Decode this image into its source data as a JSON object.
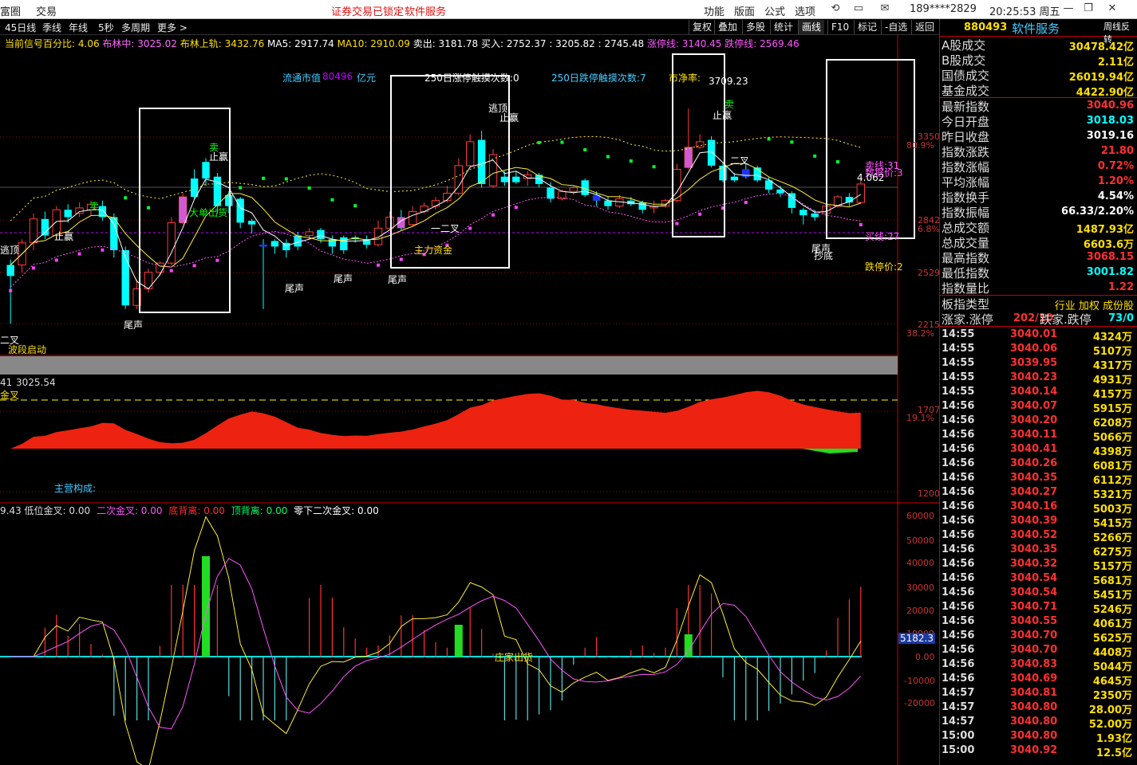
{
  "topbar": {
    "left_items": [
      "富圈",
      "交易"
    ],
    "notice": "证券交易已锁定",
    "notice_link": "软件服务",
    "right_menu": [
      "功能",
      "版面",
      "公式",
      "选项"
    ],
    "user": "189****2829",
    "clock": "20:25:53 周五"
  },
  "chart_menu": {
    "periods": [
      "45日线",
      "季线",
      "年线",
      "5秒",
      "多周期",
      "更多 >"
    ],
    "tools": [
      "复权",
      "叠加",
      "多股",
      "统计",
      "画线",
      "F10",
      "标记",
      "-自选",
      "返回"
    ]
  },
  "indicator_line": {
    "label": "当前信号百分比:",
    "value": "4.06",
    "boll_mid": "布林中: 3025.02",
    "boll_up": "布林上轨: 3432.76",
    "ma5": "MA5: 2917.74",
    "ma10": "MA10: 2910.09",
    "sell": "卖出: 3181.78",
    "buy": "买入: 2752.37",
    "p3": ": 3205.82 : 2745.48",
    "zhangting": "涨停线: 3140.45",
    "dieting": "跌停线: 2569.46"
  },
  "main_annotations": {
    "liutong": "流通市值",
    "liutong_val": "80496",
    "liutong_unit": "亿元",
    "ztcount": "250日涨停触摸次数:0",
    "dtcount": "250日跌停触摸次数:7",
    "pe": "市净率:",
    "high_mark": "3709.23",
    "sell_line": "卖线:31",
    "shuju": "数据价:3",
    "last_val": "4.062",
    "buy_line": "买线:27",
    "dieting_price": "跌停价:2",
    "labels": [
      "逃顶",
      "止赢",
      "卖",
      "卖",
      "止赢",
      "大单出货",
      "逃顶",
      "止赢",
      "卖",
      "止赢",
      "尾声",
      "尾声",
      "尾声",
      "尾声",
      "尾声",
      "主力资金",
      "二叉",
      "二叉",
      "一二叉",
      "波段启动",
      "抄底",
      "金叉"
    ],
    "right_prices": [
      "3350",
      "80.9%",
      "2842",
      "6.8%",
      "2529",
      "2215",
      "38.2%"
    ]
  },
  "sub1": {
    "label": "41",
    "value": "3025.54",
    "main_label": "主营构成:",
    "right_prices": [
      "1707",
      "19.1%",
      "1200"
    ]
  },
  "sub2": {
    "header": "9.43 低位金叉: 0.00",
    "erci": "二次金叉: 0.00",
    "dibei": "底背离: 0.00",
    "dingbei": "顶背离: 0.00",
    "lingxia": "零下二次金叉: 0.00",
    "zhuangjia": "庄家出货",
    "axis": [
      "60000",
      "50000",
      "40000",
      "30000",
      "20000",
      "10000",
      "0.00",
      "-10000",
      "-20000"
    ],
    "current": "5182.3"
  },
  "right_panel": {
    "code": "880493",
    "name": "软件服务",
    "ext": "周线反转",
    "stats": [
      {
        "label": "A股成交",
        "value": "30478.42亿",
        "color": "#ffe000"
      },
      {
        "label": "B股成交",
        "value": "2.11亿",
        "color": "#ffe000"
      },
      {
        "label": "国债成交",
        "value": "26019.94亿",
        "color": "#ffe000"
      },
      {
        "label": "基金成交",
        "value": "4422.90亿",
        "color": "#ffe000"
      }
    ],
    "index": [
      {
        "label": "最新指数",
        "value": "3040.96",
        "color": "#ff3030"
      },
      {
        "label": "今日开盘",
        "value": "3018.03",
        "color": "#00ffff"
      },
      {
        "label": "昨日收盘",
        "value": "3019.16",
        "color": "#ffffff"
      },
      {
        "label": "指数涨跌",
        "value": "21.80",
        "color": "#ff3030"
      },
      {
        "label": "指数涨幅",
        "value": "0.72%",
        "color": "#ff3030"
      },
      {
        "label": "平均涨幅",
        "value": "1.20%",
        "color": "#ff3030"
      },
      {
        "label": "指数换手",
        "value": "4.54%",
        "color": "#ffffff"
      },
      {
        "label": "指数振幅",
        "value": "66.33/2.20%",
        "color": "#ffffff"
      },
      {
        "label": "总成交额",
        "value": "1487.93亿",
        "color": "#ffe000"
      },
      {
        "label": "总成交量",
        "value": "6603.6万",
        "color": "#ffe000"
      },
      {
        "label": "最高指数",
        "value": "3068.15",
        "color": "#ff3030"
      },
      {
        "label": "最低指数",
        "value": "3001.82",
        "color": "#00ffff"
      },
      {
        "label": "指数量比",
        "value": "1.22",
        "color": "#ff3030"
      }
    ],
    "board_type": "板指类型",
    "board_links": "行业 加权 成份股",
    "zj_label": "涨家.涨停",
    "zj_val": "202/10",
    "dj_label": "跌家.跌停",
    "dj_val": "73/0",
    "ticks": [
      [
        "14:55",
        "3040.01",
        "4324万"
      ],
      [
        "14:55",
        "3040.06",
        "5107万"
      ],
      [
        "14:55",
        "3039.95",
        "4317万"
      ],
      [
        "14:55",
        "3040.23",
        "4931万"
      ],
      [
        "14:55",
        "3040.14",
        "4157万"
      ],
      [
        "14:56",
        "3040.07",
        "5915万"
      ],
      [
        "14:56",
        "3040.20",
        "6208万"
      ],
      [
        "14:56",
        "3040.11",
        "5066万"
      ],
      [
        "14:56",
        "3040.41",
        "4398万"
      ],
      [
        "14:56",
        "3040.26",
        "6081万"
      ],
      [
        "14:56",
        "3040.35",
        "6112万"
      ],
      [
        "14:56",
        "3040.27",
        "5321万"
      ],
      [
        "14:56",
        "3040.16",
        "5003万"
      ],
      [
        "14:56",
        "3040.39",
        "5415万"
      ],
      [
        "14:56",
        "3040.52",
        "5266万"
      ],
      [
        "14:56",
        "3040.35",
        "6275万"
      ],
      [
        "14:56",
        "3040.32",
        "5157万"
      ],
      [
        "14:56",
        "3040.54",
        "5681万"
      ],
      [
        "14:56",
        "3040.54",
        "5451万"
      ],
      [
        "14:56",
        "3040.71",
        "5246万"
      ],
      [
        "14:56",
        "3040.55",
        "4061万"
      ],
      [
        "14:56",
        "3040.70",
        "5625万"
      ],
      [
        "14:56",
        "3040.70",
        "4408万"
      ],
      [
        "14:56",
        "3040.83",
        "5044万"
      ],
      [
        "14:56",
        "3040.69",
        "4645万"
      ],
      [
        "14:57",
        "3040.81",
        "2350万"
      ],
      [
        "14:57",
        "3040.80",
        "28.00万"
      ],
      [
        "14:57",
        "3040.80",
        "52.00万"
      ],
      [
        "15:00",
        "3040.80",
        "1.93亿"
      ],
      [
        "15:00",
        "3040.92",
        "12.5亿"
      ]
    ]
  },
  "candles": [
    {
      "o": 2690,
      "c": 2720,
      "h": 2735,
      "l": 2560,
      "up": false
    },
    {
      "o": 2720,
      "c": 2780,
      "h": 2790,
      "l": 2700,
      "up": true
    },
    {
      "o": 2780,
      "c": 2845,
      "h": 2860,
      "l": 2760,
      "up": true
    },
    {
      "o": 2845,
      "c": 2800,
      "h": 2865,
      "l": 2790,
      "up": false
    },
    {
      "o": 2800,
      "c": 2870,
      "h": 2880,
      "l": 2790,
      "up": true
    },
    {
      "o": 2870,
      "c": 2850,
      "h": 2885,
      "l": 2835,
      "up": false
    },
    {
      "o": 2860,
      "c": 2875,
      "h": 2890,
      "l": 2850,
      "up": true
    },
    {
      "o": 2870,
      "c": 2885,
      "h": 2895,
      "l": 2855,
      "up": true
    },
    {
      "o": 2880,
      "c": 2850,
      "h": 2895,
      "l": 2840,
      "up": false
    },
    {
      "o": 2850,
      "c": 2760,
      "h": 2860,
      "l": 2740,
      "up": false
    },
    {
      "o": 2760,
      "c": 2610,
      "h": 2770,
      "l": 2600,
      "up": false
    },
    {
      "o": 2610,
      "c": 2655,
      "h": 2680,
      "l": 2600,
      "up": true
    },
    {
      "o": 2655,
      "c": 2700,
      "h": 2710,
      "l": 2645,
      "up": true
    },
    {
      "o": 2700,
      "c": 2725,
      "h": 2730,
      "l": 2690,
      "up": true
    },
    {
      "o": 2725,
      "c": 2835,
      "h": 2850,
      "l": 2720,
      "up": true
    },
    {
      "o": 2835,
      "c": 2905,
      "h": 2915,
      "l": 2830,
      "up": true
    },
    {
      "o": 2905,
      "c": 2955,
      "h": 2980,
      "l": 2900,
      "up": false
    },
    {
      "o": 2955,
      "c": 3000,
      "h": 3010,
      "l": 2935,
      "up": false
    },
    {
      "o": 2960,
      "c": 2880,
      "h": 2970,
      "l": 2860,
      "up": false
    },
    {
      "o": 2880,
      "c": 2910,
      "h": 2920,
      "l": 2860,
      "up": false
    },
    {
      "o": 2900,
      "c": 2835,
      "h": 2905,
      "l": 2820,
      "up": false
    },
    {
      "o": 2830,
      "c": 2840,
      "h": 2845,
      "l": 2805,
      "up": false
    },
    {
      "o": 2775,
      "c": 2770,
      "h": 2790,
      "l": 2600,
      "up": false
    },
    {
      "o": 2770,
      "c": 2785,
      "h": 2790,
      "l": 2750,
      "up": false
    },
    {
      "o": 2780,
      "c": 2760,
      "h": 2790,
      "l": 2740,
      "up": false
    },
    {
      "o": 2770,
      "c": 2800,
      "h": 2810,
      "l": 2760,
      "up": false
    },
    {
      "o": 2800,
      "c": 2810,
      "h": 2820,
      "l": 2790,
      "up": true
    },
    {
      "o": 2815,
      "c": 2790,
      "h": 2820,
      "l": 2780,
      "up": false
    },
    {
      "o": 2790,
      "c": 2770,
      "h": 2800,
      "l": 2750,
      "up": false
    },
    {
      "o": 2760,
      "c": 2795,
      "h": 2800,
      "l": 2750,
      "up": false
    },
    {
      "o": 2795,
      "c": 2790,
      "h": 2800,
      "l": 2780,
      "up": false
    },
    {
      "o": 2790,
      "c": 2775,
      "h": 2800,
      "l": 2765,
      "up": false
    },
    {
      "o": 2775,
      "c": 2820,
      "h": 2840,
      "l": 2770,
      "up": true
    },
    {
      "o": 2820,
      "c": 2850,
      "h": 2865,
      "l": 2815,
      "up": true
    },
    {
      "o": 2820,
      "c": 2850,
      "h": 2870,
      "l": 2815,
      "up": false
    },
    {
      "o": 2830,
      "c": 2865,
      "h": 2880,
      "l": 2825,
      "up": true
    },
    {
      "o": 2865,
      "c": 2880,
      "h": 2890,
      "l": 2860,
      "up": true
    },
    {
      "o": 2880,
      "c": 2895,
      "h": 2905,
      "l": 2870,
      "up": true
    },
    {
      "o": 2895,
      "c": 2915,
      "h": 2935,
      "l": 2890,
      "up": true
    },
    {
      "o": 2915,
      "c": 2990,
      "h": 3010,
      "l": 2910,
      "up": true
    },
    {
      "o": 2990,
      "c": 3055,
      "h": 3075,
      "l": 2985,
      "up": true
    },
    {
      "o": 3060,
      "c": 2940,
      "h": 3085,
      "l": 2930,
      "up": false
    },
    {
      "o": 2935,
      "c": 3020,
      "h": 3035,
      "l": 2930,
      "up": true
    },
    {
      "o": 2960,
      "c": 2945,
      "h": 2975,
      "l": 2935,
      "up": false
    },
    {
      "o": 2945,
      "c": 2960,
      "h": 2975,
      "l": 2940,
      "up": false
    },
    {
      "o": 2955,
      "c": 2965,
      "h": 2975,
      "l": 2935,
      "up": true
    },
    {
      "o": 2965,
      "c": 2940,
      "h": 2970,
      "l": 2930,
      "up": false
    },
    {
      "o": 2930,
      "c": 2900,
      "h": 2945,
      "l": 2890,
      "up": false
    },
    {
      "o": 2900,
      "c": 2920,
      "h": 2925,
      "l": 2895,
      "up": true
    },
    {
      "o": 2920,
      "c": 2930,
      "h": 2935,
      "l": 2910,
      "up": true
    },
    {
      "o": 2950,
      "c": 2910,
      "h": 2955,
      "l": 2905,
      "up": false
    },
    {
      "o": 2910,
      "c": 2895,
      "h": 2920,
      "l": 2880,
      "up": false
    },
    {
      "o": 2895,
      "c": 2880,
      "h": 2905,
      "l": 2870,
      "up": false
    },
    {
      "o": 2880,
      "c": 2900,
      "h": 2910,
      "l": 2875,
      "up": true
    },
    {
      "o": 2895,
      "c": 2885,
      "h": 2905,
      "l": 2880,
      "up": false
    },
    {
      "o": 2890,
      "c": 2870,
      "h": 2895,
      "l": 2860,
      "up": false
    },
    {
      "o": 2875,
      "c": 2880,
      "h": 2895,
      "l": 2860,
      "up": true
    },
    {
      "o": 2880,
      "c": 2895,
      "h": 2900,
      "l": 2875,
      "up": true
    },
    {
      "o": 2895,
      "c": 2980,
      "h": 2995,
      "l": 2890,
      "up": true
    },
    {
      "o": 2985,
      "c": 3040,
      "h": 3145,
      "l": 2980,
      "up": true
    },
    {
      "o": 3040,
      "c": 3055,
      "h": 3075,
      "l": 3035,
      "up": true
    },
    {
      "o": 3060,
      "c": 2990,
      "h": 3070,
      "l": 2985,
      "up": false
    },
    {
      "o": 2990,
      "c": 2950,
      "h": 3000,
      "l": 2945,
      "up": false
    },
    {
      "o": 2950,
      "c": 2960,
      "h": 2970,
      "l": 2945,
      "up": false
    },
    {
      "o": 2960,
      "c": 2980,
      "h": 2995,
      "l": 2955,
      "up": false
    },
    {
      "o": 2985,
      "c": 2950,
      "h": 2990,
      "l": 2945,
      "up": false
    },
    {
      "o": 2950,
      "c": 2925,
      "h": 2960,
      "l": 2915,
      "up": false
    },
    {
      "o": 2925,
      "c": 2915,
      "h": 2935,
      "l": 2905,
      "up": false
    },
    {
      "o": 2915,
      "c": 2875,
      "h": 2920,
      "l": 2860,
      "up": false
    },
    {
      "o": 2870,
      "c": 2855,
      "h": 2875,
      "l": 2830,
      "up": false
    },
    {
      "o": 2850,
      "c": 2860,
      "h": 2870,
      "l": 2840,
      "up": false
    },
    {
      "o": 2860,
      "c": 2880,
      "h": 2890,
      "l": 2855,
      "up": true
    },
    {
      "o": 2880,
      "c": 2905,
      "h": 2910,
      "l": 2875,
      "up": true
    },
    {
      "o": 2905,
      "c": 2890,
      "h": 2915,
      "l": 2880,
      "up": false
    },
    {
      "o": 2890,
      "c": 2940,
      "h": 2950,
      "l": 2885,
      "up": true
    }
  ]
}
